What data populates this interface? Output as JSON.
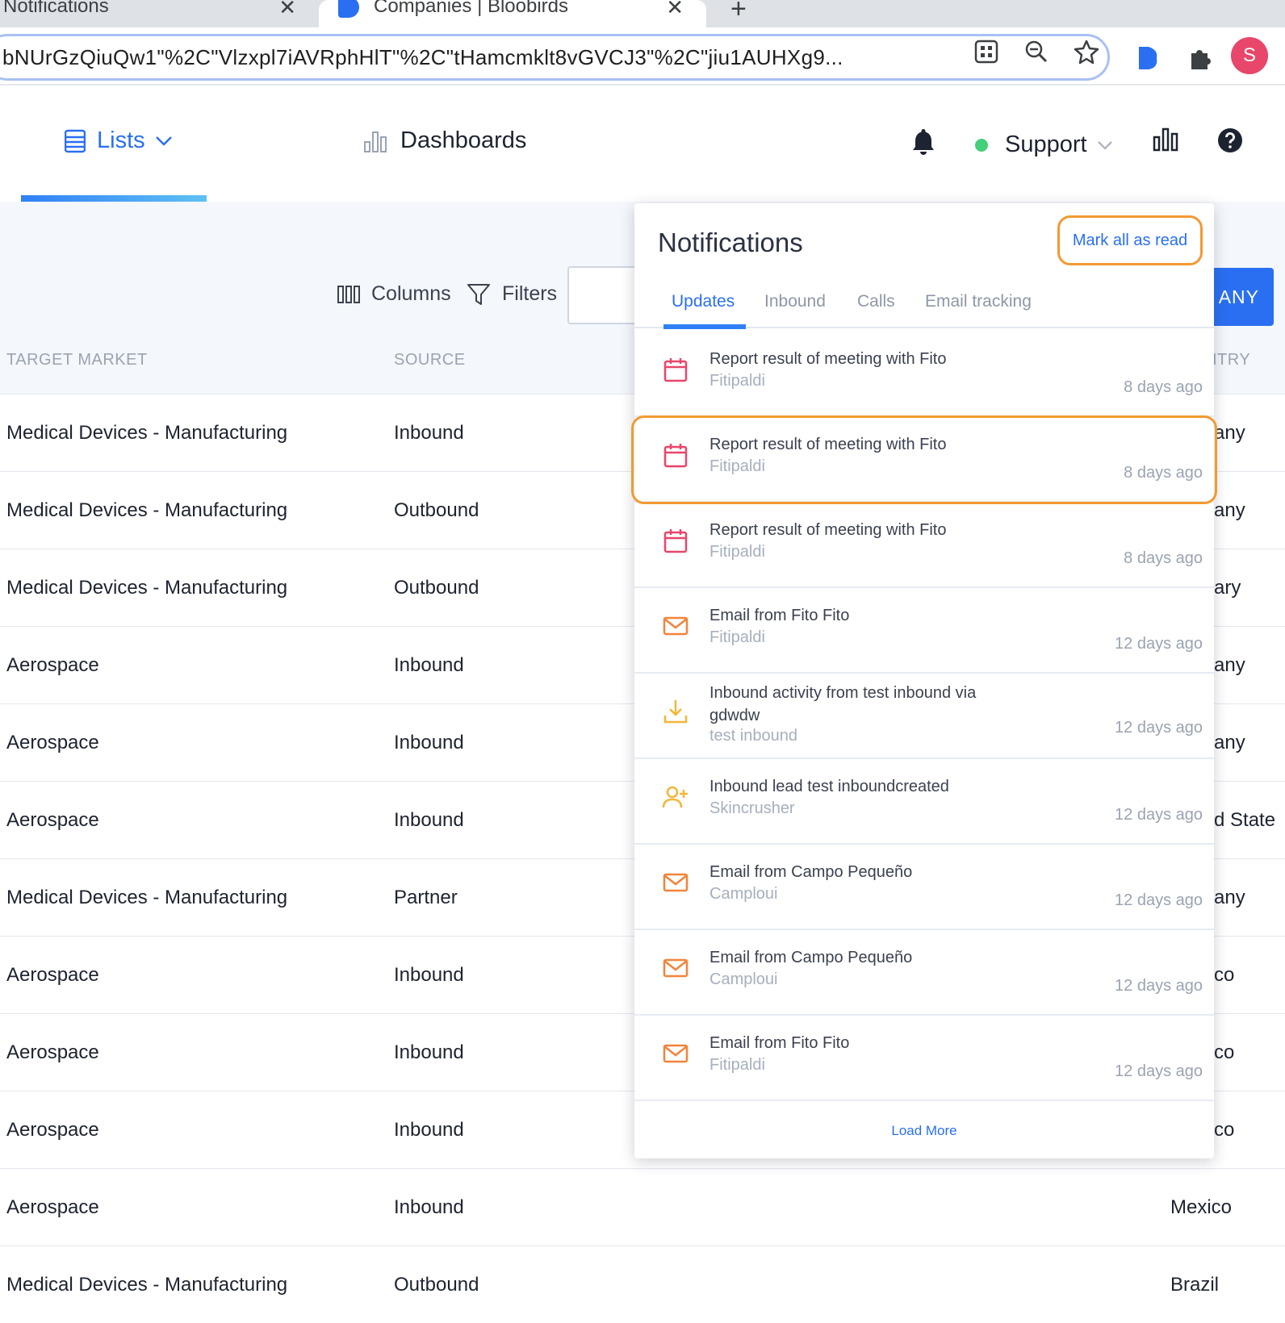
{
  "browser": {
    "tabs": [
      {
        "title": "Notifications",
        "close": "✕"
      },
      {
        "title": "Companies | Bloobirds",
        "close": "✕"
      }
    ],
    "new_tab": "+",
    "url": "bNUrGzQiuQw1\"%2C\"Vlzxpl7iAVRphHlT\"%2C\"tHamcmklt8vGVCJ3\"%2C\"jiu1AUHXg9...",
    "profile_initial": "S",
    "profile_color": "#e8466a"
  },
  "header": {
    "lists_label": "Lists",
    "dashboards_label": "Dashboards",
    "support_label": "Support",
    "status_color": "#44cf7b"
  },
  "toolbar": {
    "columns_label": "Columns",
    "filters_label": "Filters",
    "add_button_label": "ANY"
  },
  "table": {
    "columns": [
      "TARGET MARKET",
      "SOURCE",
      "ITRY"
    ],
    "rows": [
      {
        "target_market": "Medical Devices - Manufacturing",
        "source": "Inbound",
        "country": "any"
      },
      {
        "target_market": "Medical Devices - Manufacturing",
        "source": "Outbound",
        "country": "any"
      },
      {
        "target_market": "Medical Devices - Manufacturing",
        "source": "Outbound",
        "country": "ary"
      },
      {
        "target_market": "Aerospace",
        "source": "Inbound",
        "country": "any"
      },
      {
        "target_market": "Aerospace",
        "source": "Inbound",
        "country": "any"
      },
      {
        "target_market": "Aerospace",
        "source": "Inbound",
        "country": "d State"
      },
      {
        "target_market": "Medical Devices - Manufacturing",
        "source": "Partner",
        "country": "any"
      },
      {
        "target_market": "Aerospace",
        "source": "Inbound",
        "country": "co"
      },
      {
        "target_market": "Aerospace",
        "source": "Inbound",
        "country": "co"
      },
      {
        "target_market": "Aerospace",
        "source": "Inbound",
        "country": "co"
      },
      {
        "target_market": "Aerospace",
        "source": "Inbound",
        "country": "Mexico"
      },
      {
        "target_market": "Medical Devices - Manufacturing",
        "source": "Outbound",
        "country": "Brazil"
      }
    ]
  },
  "notifications": {
    "title": "Notifications",
    "mark_all_read": "Mark all as read",
    "tabs": [
      "Updates",
      "Inbound",
      "Calls",
      "Email tracking"
    ],
    "active_tab": "Updates",
    "items": [
      {
        "icon": "calendar-icon",
        "title": "Report result of meeting with Fito",
        "subtitle": "Fitipaldi",
        "time": "8 days ago"
      },
      {
        "icon": "calendar-icon",
        "title": "Report result of meeting with Fito",
        "subtitle": "Fitipaldi",
        "time": "8 days ago"
      },
      {
        "icon": "calendar-icon",
        "title": "Report result of meeting with Fito",
        "subtitle": "Fitipaldi",
        "time": "8 days ago"
      },
      {
        "icon": "mail-icon",
        "title": "Email from Fito Fito",
        "subtitle": "Fitipaldi",
        "time": "12 days ago"
      },
      {
        "icon": "download-icon",
        "title": "Inbound activity from test inbound via gdwdw",
        "subtitle": "test inbound",
        "time": "12 days ago"
      },
      {
        "icon": "user-plus-icon",
        "title": "Inbound lead test inboundcreated",
        "subtitle": "Skincrusher",
        "time": "12 days ago"
      },
      {
        "icon": "mail-icon",
        "title": "Email from Campo Pequeño",
        "subtitle": "Camploui",
        "time": "12 days ago"
      },
      {
        "icon": "mail-icon",
        "title": "Email from Campo Pequeño",
        "subtitle": "Camploui",
        "time": "12 days ago"
      },
      {
        "icon": "mail-icon",
        "title": "Email from Fito Fito",
        "subtitle": "Fitipaldi",
        "time": "12 days ago"
      }
    ],
    "load_more": "Load More",
    "calendar_color": "#e8466a",
    "mail_color": "#f2843a",
    "inbound_color": "#f2b63a",
    "highlight_color": "#f29a32"
  }
}
